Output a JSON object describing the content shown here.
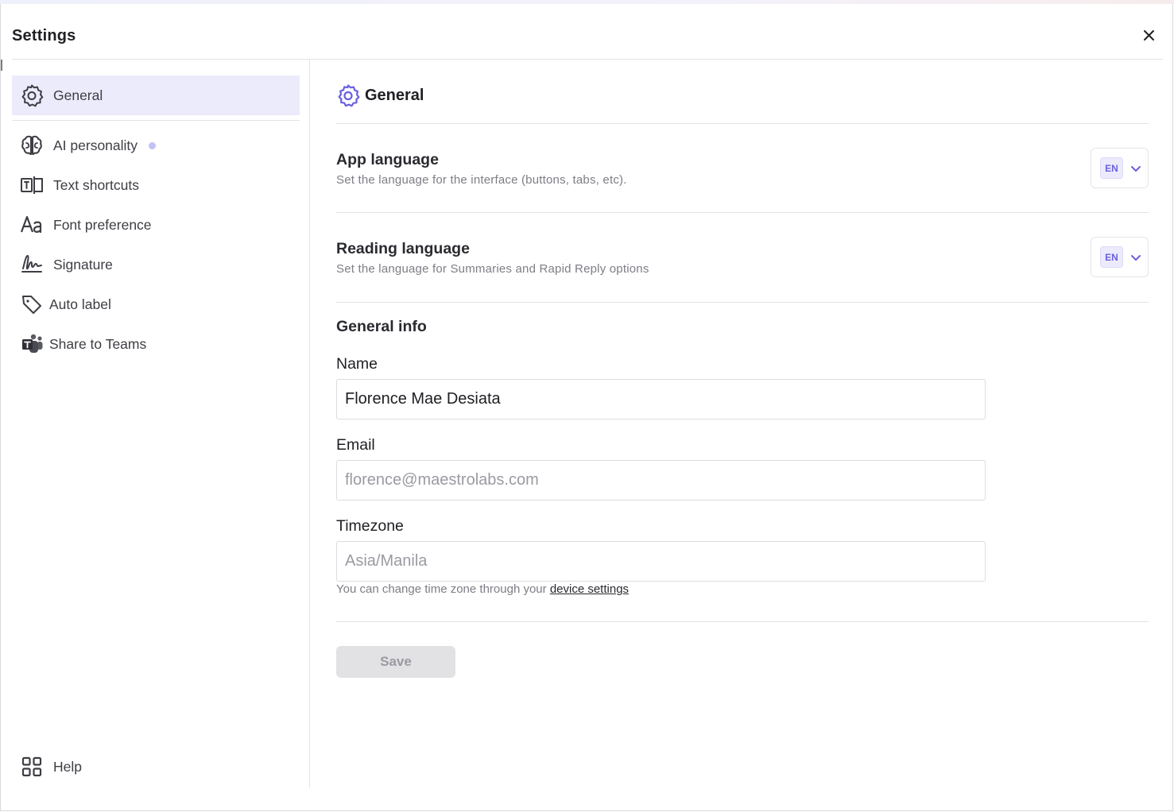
{
  "window": {
    "title": "Settings"
  },
  "sidebar": {
    "items": [
      {
        "label": "General",
        "icon": "gear-icon",
        "active": true
      },
      {
        "label": "AI personality",
        "icon": "brain-icon",
        "has_dot": true
      },
      {
        "label": "Text shortcuts",
        "icon": "text-shortcut-icon"
      },
      {
        "label": "Font preference",
        "icon": "font-icon"
      },
      {
        "label": "Signature",
        "icon": "signature-icon"
      },
      {
        "label": "Auto label",
        "icon": "tag-icon"
      },
      {
        "label": "Share to Teams",
        "icon": "teams-icon"
      }
    ],
    "help_label": "Help"
  },
  "main": {
    "section_title": "General",
    "app_language": {
      "title": "App language",
      "description": "Set the language for the interface (buttons, tabs, etc).",
      "value": "EN"
    },
    "reading_language": {
      "title": "Reading language",
      "description": "Set the language for Summaries and Rapid Reply options",
      "value": "EN"
    },
    "general_info": {
      "title": "General info",
      "name_label": "Name",
      "name_value": "Florence Mae Desiata",
      "email_label": "Email",
      "email_value": "florence@maestrolabs.com",
      "timezone_label": "Timezone",
      "timezone_value": "Asia/Manila",
      "timezone_hint": "You can change time zone through your ",
      "timezone_link": "device settings"
    },
    "save_label": "Save"
  },
  "colors": {
    "accent": "#6a5fe0",
    "active_bg": "#ecebfc",
    "dot": "#c3c1f7",
    "save_bg": "#e2e2e5"
  }
}
